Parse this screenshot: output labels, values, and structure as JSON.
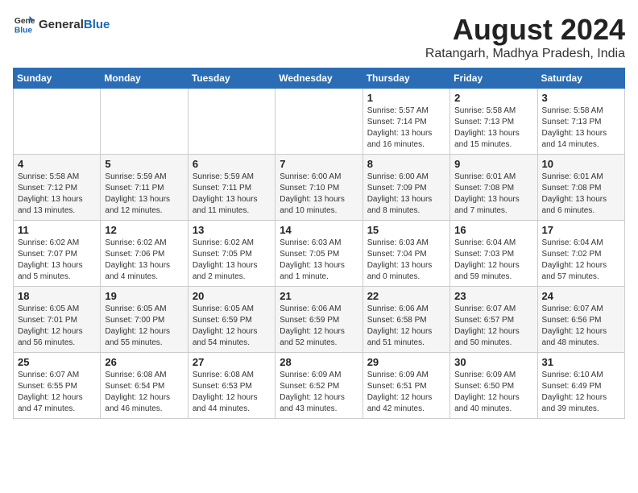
{
  "header": {
    "logo_general": "General",
    "logo_blue": "Blue",
    "title": "August 2024",
    "location": "Ratangarh, Madhya Pradesh, India"
  },
  "calendar": {
    "days_of_week": [
      "Sunday",
      "Monday",
      "Tuesday",
      "Wednesday",
      "Thursday",
      "Friday",
      "Saturday"
    ],
    "weeks": [
      [
        {
          "day": "",
          "info": ""
        },
        {
          "day": "",
          "info": ""
        },
        {
          "day": "",
          "info": ""
        },
        {
          "day": "",
          "info": ""
        },
        {
          "day": "1",
          "info": "Sunrise: 5:57 AM\nSunset: 7:14 PM\nDaylight: 13 hours\nand 16 minutes."
        },
        {
          "day": "2",
          "info": "Sunrise: 5:58 AM\nSunset: 7:13 PM\nDaylight: 13 hours\nand 15 minutes."
        },
        {
          "day": "3",
          "info": "Sunrise: 5:58 AM\nSunset: 7:13 PM\nDaylight: 13 hours\nand 14 minutes."
        }
      ],
      [
        {
          "day": "4",
          "info": "Sunrise: 5:58 AM\nSunset: 7:12 PM\nDaylight: 13 hours\nand 13 minutes."
        },
        {
          "day": "5",
          "info": "Sunrise: 5:59 AM\nSunset: 7:11 PM\nDaylight: 13 hours\nand 12 minutes."
        },
        {
          "day": "6",
          "info": "Sunrise: 5:59 AM\nSunset: 7:11 PM\nDaylight: 13 hours\nand 11 minutes."
        },
        {
          "day": "7",
          "info": "Sunrise: 6:00 AM\nSunset: 7:10 PM\nDaylight: 13 hours\nand 10 minutes."
        },
        {
          "day": "8",
          "info": "Sunrise: 6:00 AM\nSunset: 7:09 PM\nDaylight: 13 hours\nand 8 minutes."
        },
        {
          "day": "9",
          "info": "Sunrise: 6:01 AM\nSunset: 7:08 PM\nDaylight: 13 hours\nand 7 minutes."
        },
        {
          "day": "10",
          "info": "Sunrise: 6:01 AM\nSunset: 7:08 PM\nDaylight: 13 hours\nand 6 minutes."
        }
      ],
      [
        {
          "day": "11",
          "info": "Sunrise: 6:02 AM\nSunset: 7:07 PM\nDaylight: 13 hours\nand 5 minutes."
        },
        {
          "day": "12",
          "info": "Sunrise: 6:02 AM\nSunset: 7:06 PM\nDaylight: 13 hours\nand 4 minutes."
        },
        {
          "day": "13",
          "info": "Sunrise: 6:02 AM\nSunset: 7:05 PM\nDaylight: 13 hours\nand 2 minutes."
        },
        {
          "day": "14",
          "info": "Sunrise: 6:03 AM\nSunset: 7:05 PM\nDaylight: 13 hours\nand 1 minute."
        },
        {
          "day": "15",
          "info": "Sunrise: 6:03 AM\nSunset: 7:04 PM\nDaylight: 13 hours\nand 0 minutes."
        },
        {
          "day": "16",
          "info": "Sunrise: 6:04 AM\nSunset: 7:03 PM\nDaylight: 12 hours\nand 59 minutes."
        },
        {
          "day": "17",
          "info": "Sunrise: 6:04 AM\nSunset: 7:02 PM\nDaylight: 12 hours\nand 57 minutes."
        }
      ],
      [
        {
          "day": "18",
          "info": "Sunrise: 6:05 AM\nSunset: 7:01 PM\nDaylight: 12 hours\nand 56 minutes."
        },
        {
          "day": "19",
          "info": "Sunrise: 6:05 AM\nSunset: 7:00 PM\nDaylight: 12 hours\nand 55 minutes."
        },
        {
          "day": "20",
          "info": "Sunrise: 6:05 AM\nSunset: 6:59 PM\nDaylight: 12 hours\nand 54 minutes."
        },
        {
          "day": "21",
          "info": "Sunrise: 6:06 AM\nSunset: 6:59 PM\nDaylight: 12 hours\nand 52 minutes."
        },
        {
          "day": "22",
          "info": "Sunrise: 6:06 AM\nSunset: 6:58 PM\nDaylight: 12 hours\nand 51 minutes."
        },
        {
          "day": "23",
          "info": "Sunrise: 6:07 AM\nSunset: 6:57 PM\nDaylight: 12 hours\nand 50 minutes."
        },
        {
          "day": "24",
          "info": "Sunrise: 6:07 AM\nSunset: 6:56 PM\nDaylight: 12 hours\nand 48 minutes."
        }
      ],
      [
        {
          "day": "25",
          "info": "Sunrise: 6:07 AM\nSunset: 6:55 PM\nDaylight: 12 hours\nand 47 minutes."
        },
        {
          "day": "26",
          "info": "Sunrise: 6:08 AM\nSunset: 6:54 PM\nDaylight: 12 hours\nand 46 minutes."
        },
        {
          "day": "27",
          "info": "Sunrise: 6:08 AM\nSunset: 6:53 PM\nDaylight: 12 hours\nand 44 minutes."
        },
        {
          "day": "28",
          "info": "Sunrise: 6:09 AM\nSunset: 6:52 PM\nDaylight: 12 hours\nand 43 minutes."
        },
        {
          "day": "29",
          "info": "Sunrise: 6:09 AM\nSunset: 6:51 PM\nDaylight: 12 hours\nand 42 minutes."
        },
        {
          "day": "30",
          "info": "Sunrise: 6:09 AM\nSunset: 6:50 PM\nDaylight: 12 hours\nand 40 minutes."
        },
        {
          "day": "31",
          "info": "Sunrise: 6:10 AM\nSunset: 6:49 PM\nDaylight: 12 hours\nand 39 minutes."
        }
      ]
    ]
  }
}
